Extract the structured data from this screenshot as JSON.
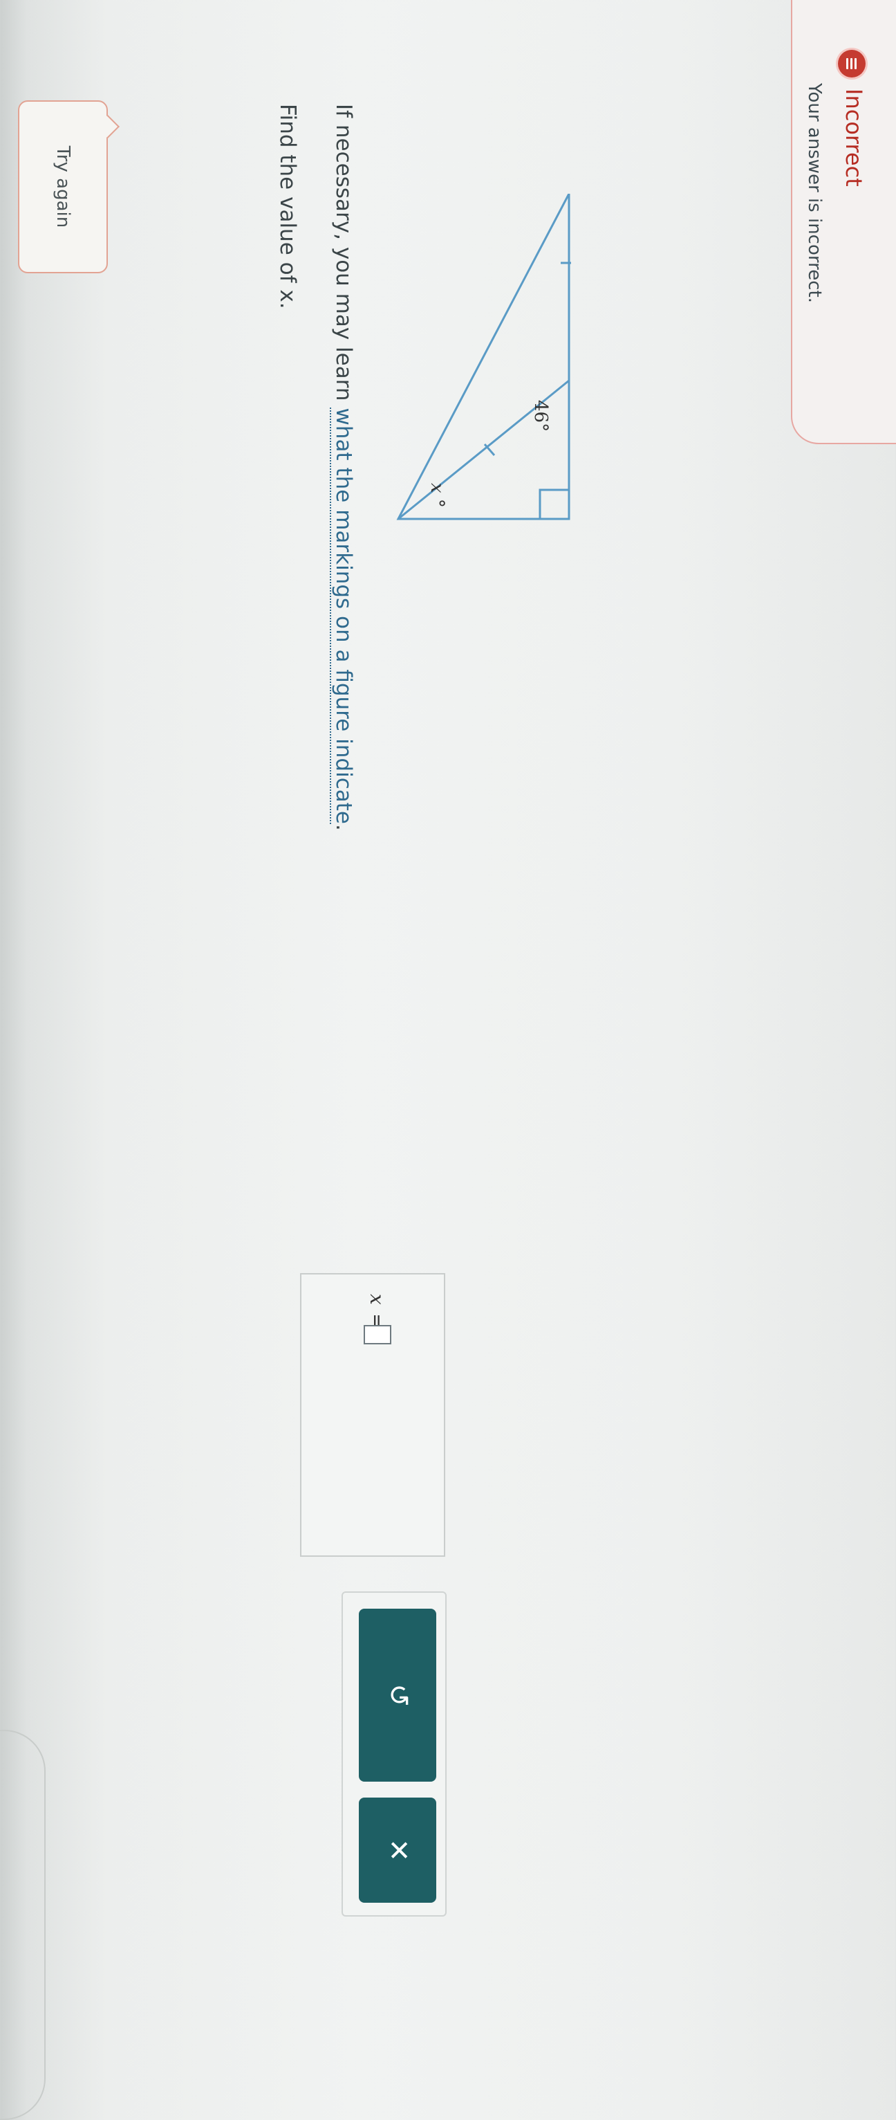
{
  "feedback": {
    "title": "Incorrect",
    "message": "Your answer is incorrect."
  },
  "try_again": {
    "label": "Try again"
  },
  "question": {
    "line1": "Find the value of x.",
    "line2_prefix": "If necessary, you may learn ",
    "line2_link": "what the markings on a figure indicate",
    "line2_suffix": "."
  },
  "figure": {
    "angle_label_46": "46°",
    "angle_label_x": "x °"
  },
  "answer": {
    "variable": "x",
    "equals": "="
  },
  "actions": {
    "undo_icon": "undo-icon",
    "undo_glyph": "↺",
    "clear_icon": "close-icon",
    "clear_glyph": "✕"
  },
  "colors": {
    "error_red": "#c53b31",
    "figure_line": "#5a9bc6",
    "button_teal": "#1e5f64",
    "link_blue": "#2f6a8e"
  }
}
